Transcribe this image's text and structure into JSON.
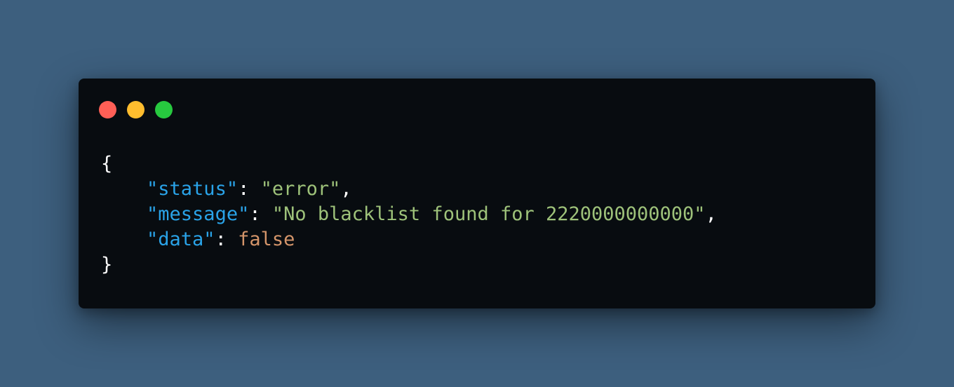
{
  "window": {
    "controls": {
      "close_color": "#ff5f56",
      "minimize_color": "#ffbd2e",
      "maximize_color": "#27c93f"
    }
  },
  "code": {
    "open_brace": "{",
    "close_brace": "}",
    "lines": [
      {
        "key": "\"status\"",
        "sep": ": ",
        "value": "\"error\"",
        "trail": ","
      },
      {
        "key": "\"message\"",
        "sep": ": ",
        "value": "\"No blacklist found for 2220000000000\"",
        "trail": ","
      },
      {
        "key": "\"data\"",
        "sep": ": ",
        "value": "false",
        "trail": ""
      }
    ]
  },
  "colors": {
    "background": "#3d5f7e",
    "window": "#080c10",
    "key": "#2aa3e8",
    "string": "#9ec27a",
    "boolean": "#d4956a"
  }
}
